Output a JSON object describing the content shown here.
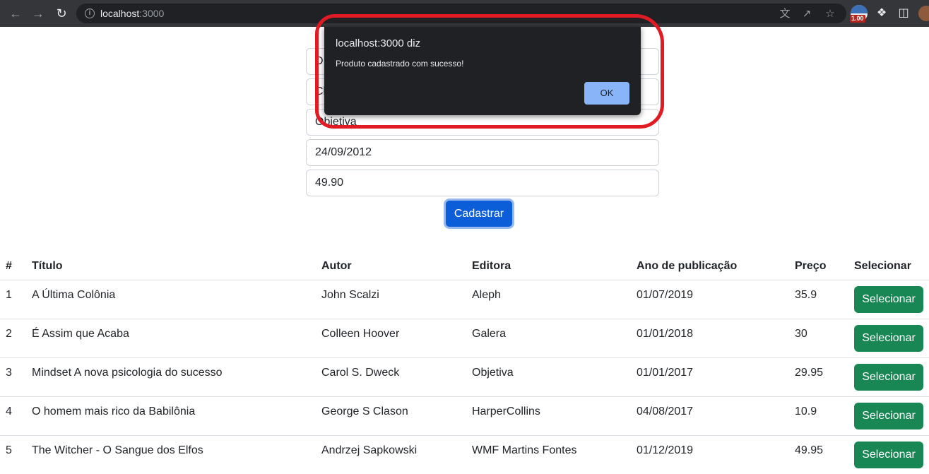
{
  "browser": {
    "url_host": "localhost",
    "url_port": ":3000",
    "extension_badge": "1.00"
  },
  "form": {
    "field1_value": "D",
    "field2_value": "Cl",
    "field3_value": "Objetiva",
    "field4_value": "24/09/2012",
    "field5_value": "49.90",
    "submit_label": "Cadastrar"
  },
  "table": {
    "headers": [
      "#",
      "Título",
      "Autor",
      "Editora",
      "Ano de publicação",
      "Preço",
      "Selecionar"
    ],
    "rows": [
      {
        "id": "1",
        "titulo": "A Última Colônia",
        "autor": "John Scalzi",
        "editora": "Aleph",
        "ano": "01/07/2019",
        "preco": "35.9",
        "action": "Selecionar"
      },
      {
        "id": "2",
        "titulo": "É Assim que Acaba",
        "autor": "Colleen Hoover",
        "editora": "Galera",
        "ano": "01/01/2018",
        "preco": "30",
        "action": "Selecionar"
      },
      {
        "id": "3",
        "titulo": "Mindset A nova psicologia do sucesso",
        "autor": "Carol S. Dweck",
        "editora": "Objetiva",
        "ano": "01/01/2017",
        "preco": "29.95",
        "action": "Selecionar"
      },
      {
        "id": "4",
        "titulo": "O homem mais rico da Babilônia",
        "autor": "George S Clason",
        "editora": "HarperCollins",
        "ano": "04/08/2017",
        "preco": "10.9",
        "action": "Selecionar"
      },
      {
        "id": "5",
        "titulo": "The Witcher - O Sangue dos Elfos",
        "autor": "Andrzej Sapkowski",
        "editora": "WMF Martins Fontes",
        "ano": "01/12/2019",
        "preco": "49.95",
        "action": "Selecionar"
      }
    ]
  },
  "dialog": {
    "title": "localhost:3000 diz",
    "message": "Produto cadastrado com sucesso!",
    "ok_label": "OK"
  },
  "colors": {
    "primary": "#0b5ed7",
    "success": "#198754",
    "dialog_bg": "#202124",
    "dialog_button": "#8ab4f8",
    "annotation": "#e01b24"
  }
}
